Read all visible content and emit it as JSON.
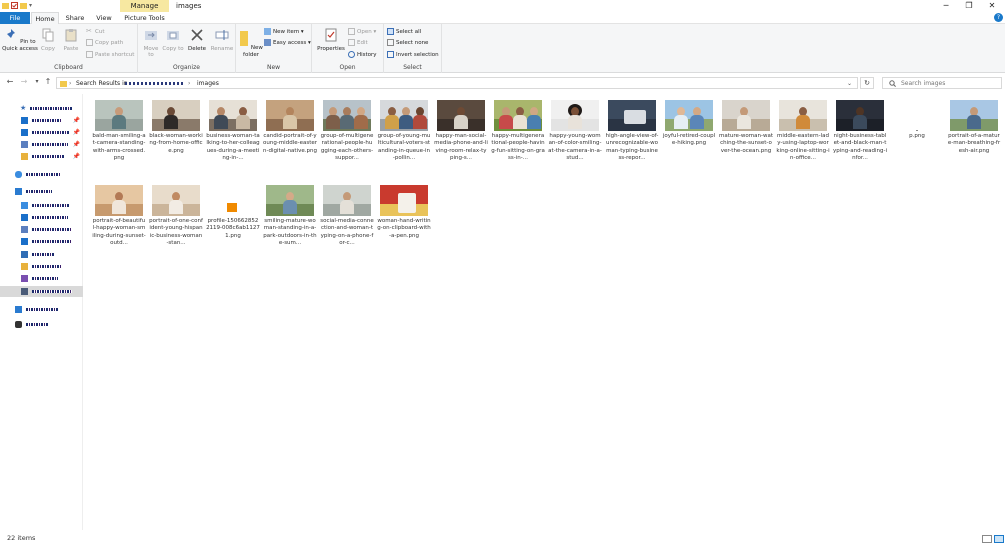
{
  "window": {
    "title": "images",
    "context_tab": "Manage"
  },
  "tabs": [
    {
      "label": "File"
    },
    {
      "label": "Home"
    },
    {
      "label": "Share"
    },
    {
      "label": "View"
    },
    {
      "label": "Picture Tools"
    }
  ],
  "ribbon": {
    "clipboard": {
      "label": "Clipboard",
      "pin": "Pin to Quick access",
      "copy": "Copy",
      "paste": "Paste",
      "cut": "Cut",
      "copy_path": "Copy path",
      "paste_shortcut": "Paste shortcut"
    },
    "organize": {
      "label": "Organize",
      "move_to": "Move to",
      "copy_to": "Copy to",
      "delete": "Delete",
      "rename": "Rename"
    },
    "new": {
      "label": "New",
      "new_folder": "New folder",
      "new_item": "New item",
      "easy_access": "Easy access"
    },
    "open": {
      "label": "Open",
      "properties": "Properties",
      "open": "Open",
      "edit": "Edit",
      "history": "History"
    },
    "select": {
      "label": "Select",
      "select_all": "Select all",
      "select_none": "Select none",
      "invert": "Invert selection"
    }
  },
  "address": {
    "prefix": "Search Results in",
    "current": "images"
  },
  "search": {
    "placeholder": "Search images"
  },
  "files": [
    {
      "name": "bald-man-smiling-at-camera-standing-with-arms-crossed.png"
    },
    {
      "name": "black-woman-working-from-home-office.png"
    },
    {
      "name": "business-woman-talking-to-her-colleagues-during-a-meeting-in-..."
    },
    {
      "name": "candid-portrait-of-young-middle-eastern-digital-native.png"
    },
    {
      "name": "group-of-multigenerational-people-hugging-each-others-suppor..."
    },
    {
      "name": "group-of-young-multicultural-voters-standing-in-queue-in-pollin..."
    },
    {
      "name": "happy-man-social-media-phone-and-living-room-relax-typing-s..."
    },
    {
      "name": "happy-multigenerational-people-having-fun-sitting-on-grass-in-..."
    },
    {
      "name": "happy-young-woman-of-color-smiling-at-the-camera-in-a-stud..."
    },
    {
      "name": "high-angle-view-of-unrecognizable-woman-typing-business-repor..."
    },
    {
      "name": "joyful-retired-couple-hiking.png"
    },
    {
      "name": "mature-woman-watching-the-sunset-over-the-ocean.png"
    },
    {
      "name": "middle-eastern-lady-using-laptop-working-online-sitting-in-office..."
    },
    {
      "name": "night-business-tablet-and-black-man-typing-and-reading-infor..."
    },
    {
      "name": "p.png"
    },
    {
      "name": "portrait-of-a-mature-man-breathing-fresh-air.png"
    },
    {
      "name": "portrait-of-beautiful-happy-woman-smiling-during-sunset-outd..."
    },
    {
      "name": "portrait-of-one-confident-young-hispanic-business-woman-stan..."
    },
    {
      "name": "profile-1506628522119-008c6ab11271.png"
    },
    {
      "name": "smiling-mature-woman-standing-in-a-park-outdoors-in-the-sum..."
    },
    {
      "name": "social-media-connection-and-woman-typing-on-a-phone-for-c..."
    },
    {
      "name": "woman-hand-writing-on-clipboard-with-a-pen.png"
    }
  ],
  "status": {
    "count": "22 items"
  },
  "colors": {
    "accent": "#1979ca",
    "manage": "#f7e8a1"
  }
}
